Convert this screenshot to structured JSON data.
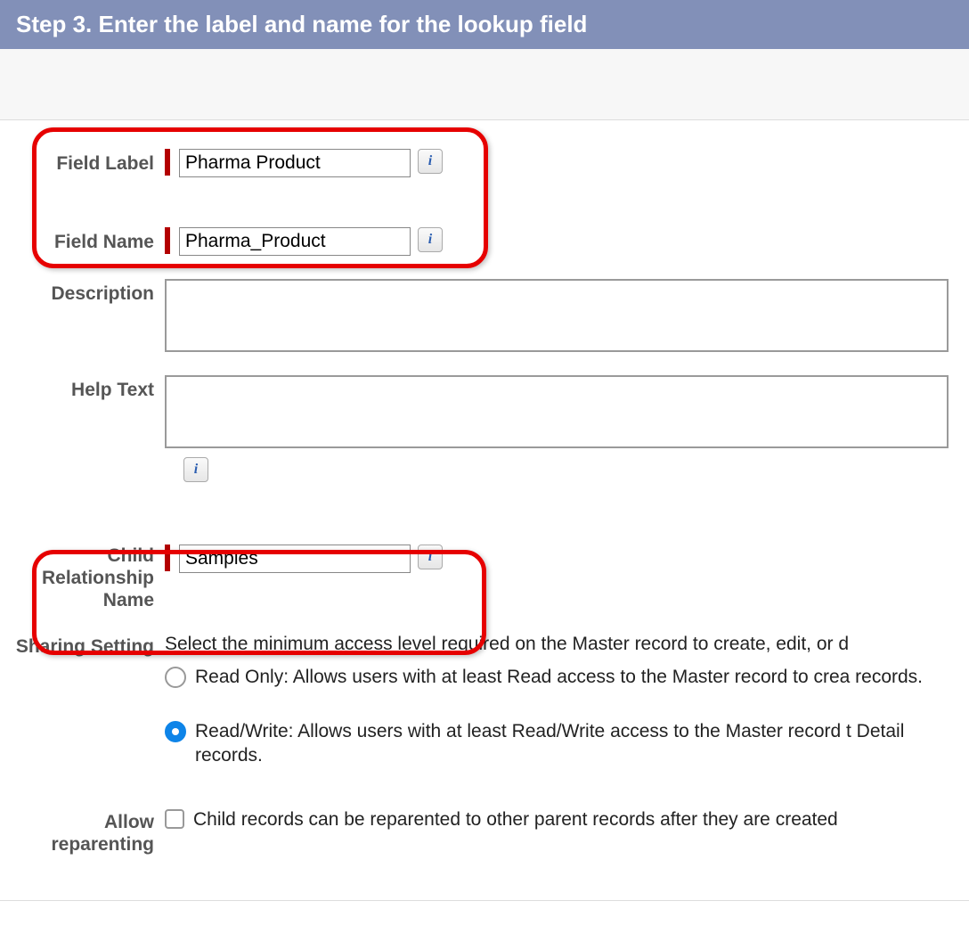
{
  "header": {
    "title": "Step 3. Enter the label and name for the lookup field"
  },
  "fields": {
    "fieldLabel": {
      "label": "Field Label",
      "value": "Pharma Product"
    },
    "fieldName": {
      "label": "Field Name",
      "value": "Pharma_Product"
    },
    "description": {
      "label": "Description",
      "value": ""
    },
    "helpText": {
      "label": "Help Text",
      "value": ""
    },
    "childRel": {
      "label": "Child Relationship Name",
      "value": "Samples"
    },
    "sharingSetting": {
      "label": "Sharing Setting",
      "intro": "Select the minimum access level required on the Master record to create, edit, or d",
      "options": [
        {
          "label": "Read Only: Allows users with at least Read access to the Master record to crea records.",
          "selected": false
        },
        {
          "label": "Read/Write: Allows users with at least Read/Write access to the Master record t Detail records.",
          "selected": true
        }
      ]
    },
    "allowReparenting": {
      "label": "Allow reparenting",
      "checkboxLabel": "Child records can be reparented to other parent records after they are created",
      "checked": false
    }
  },
  "icons": {
    "info": "i"
  }
}
